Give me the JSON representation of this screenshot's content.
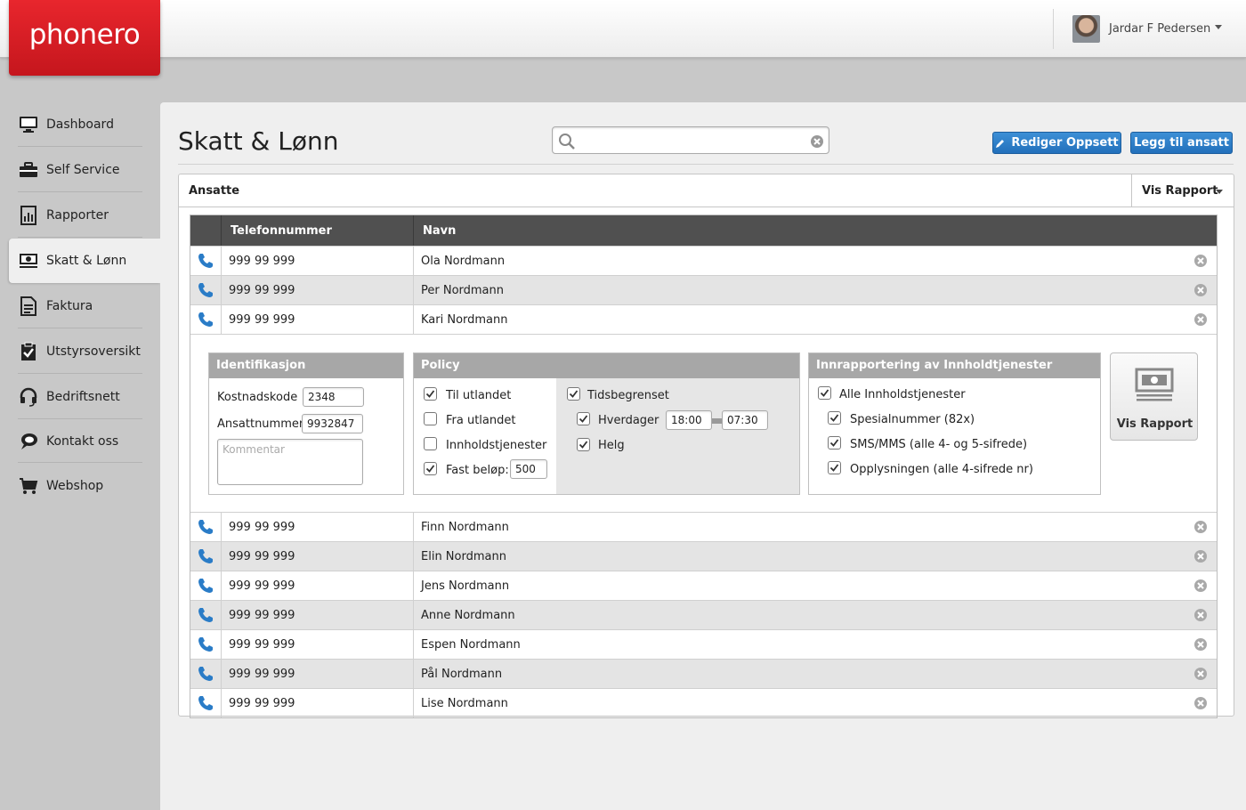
{
  "header": {
    "logo_text": "phonero",
    "user_name": "Jardar F Pedersen"
  },
  "sidebar": {
    "items": [
      {
        "label": "Dashboard",
        "icon": "monitor-icon"
      },
      {
        "label": "Self Service",
        "icon": "briefcase-icon"
      },
      {
        "label": "Rapporter",
        "icon": "report-icon"
      },
      {
        "label": "Skatt & Lønn",
        "icon": "money-icon",
        "active": true
      },
      {
        "label": "Faktura",
        "icon": "invoice-icon"
      },
      {
        "label": "Utstyrsoversikt",
        "icon": "clipboard-check-icon"
      },
      {
        "label": "Bedriftsnett",
        "icon": "headset-icon"
      },
      {
        "label": "Kontakt oss",
        "icon": "chat-icon"
      },
      {
        "label": "Webshop",
        "icon": "cart-icon"
      }
    ]
  },
  "main": {
    "title": "Skatt & Lønn",
    "search": {
      "value": "",
      "placeholder": ""
    },
    "edit_button": "Rediger Oppsett",
    "add_button": "Legg til ansatt"
  },
  "card": {
    "title": "Ansatte",
    "report_dropdown": "Vis Rapport"
  },
  "table": {
    "columns": [
      "Telefonnummer",
      "Navn"
    ],
    "rows_top": [
      {
        "phone": "999 99 999",
        "name": "Ola Nordmann"
      },
      {
        "phone": "999 99 999",
        "name": "Per Nordmann"
      },
      {
        "phone": "999 99 999",
        "name": "Kari Nordmann"
      }
    ],
    "rows_bottom": [
      {
        "phone": "999 99 999",
        "name": "Finn Nordmann"
      },
      {
        "phone": "999 99 999",
        "name": "Elin Nordmann"
      },
      {
        "phone": "999 99 999",
        "name": "Jens Nordmann"
      },
      {
        "phone": "999 99 999",
        "name": "Anne Nordmann"
      },
      {
        "phone": "999 99 999",
        "name": "Espen Nordmann"
      },
      {
        "phone": "999 99 999",
        "name": "Pål Nordmann"
      },
      {
        "phone": "999 99 999",
        "name": "Lise Nordmann"
      }
    ]
  },
  "detail": {
    "identification": {
      "title": "Identifikasjon",
      "cost_code_label": "Kostnadskode",
      "cost_code_value": "2348",
      "employee_no_label": "Ansattnummer",
      "employee_no_value": "9932847",
      "comment_placeholder": "Kommentar"
    },
    "policy": {
      "title": "Policy",
      "abroad_label": "Til utlandet",
      "abroad_checked": true,
      "from_abroad_label": "Fra utlandet",
      "from_abroad_checked": false,
      "content_label": "Innholdstjenester",
      "content_checked": false,
      "fixed_label": "Fast beløp:",
      "fixed_checked": true,
      "fixed_value": "500",
      "time_limited_label": "Tidsbegrenset",
      "time_limited_checked": true,
      "weekdays_label": "Hverdager",
      "weekdays_checked": true,
      "from_time": "18:00",
      "to_time": "07:30",
      "weekend_label": "Helg",
      "weekend_checked": true
    },
    "reporting": {
      "title": "Innrapportering av Innholdtjenester",
      "all_label": "Alle Innholdstjenester",
      "all_checked": true,
      "special_label": "Spesialnummer (82x)",
      "special_checked": true,
      "sms_label": "SMS/MMS (alle 4- og 5-sifrede)",
      "sms_checked": true,
      "info_label": "Opplysningen (alle 4-sifrede nr)",
      "info_checked": true
    },
    "report_button": "Vis Rapport"
  },
  "colors": {
    "brand_red": "#d81e25",
    "accent_blue": "#2a7cc7",
    "table_header": "#505050",
    "panel_header": "#a7a7a7"
  }
}
